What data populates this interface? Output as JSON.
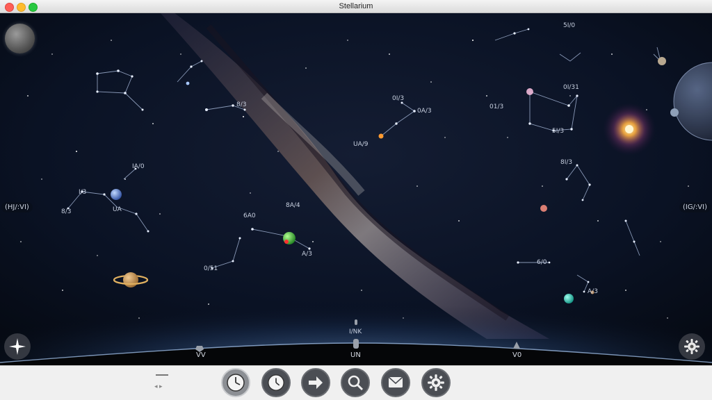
{
  "window": {
    "title": "Stellarium"
  },
  "sky": {
    "labels": [
      "0I/3",
      "0A/3",
      "UA/9",
      "0I/31",
      "01/3",
      "5I/3",
      "8I/3",
      "IA/0",
      "8A/4",
      "6A0",
      "UA",
      "8/3",
      "A/3",
      "0/51",
      "6/0",
      "5I/0",
      "8/3",
      "I/3",
      "A/3",
      "I/NK"
    ],
    "left_label": "(HJ/:VI)",
    "right_label": "(IG/:VI)"
  },
  "horizon": {
    "left": "VV",
    "center": "UN",
    "right": "V0"
  },
  "buttons": {
    "moon": "moon-view",
    "compass": "compass",
    "settings": "settings"
  },
  "toolbar": {
    "dash_symbol": "– –",
    "arrows": "◂ ▸"
  }
}
